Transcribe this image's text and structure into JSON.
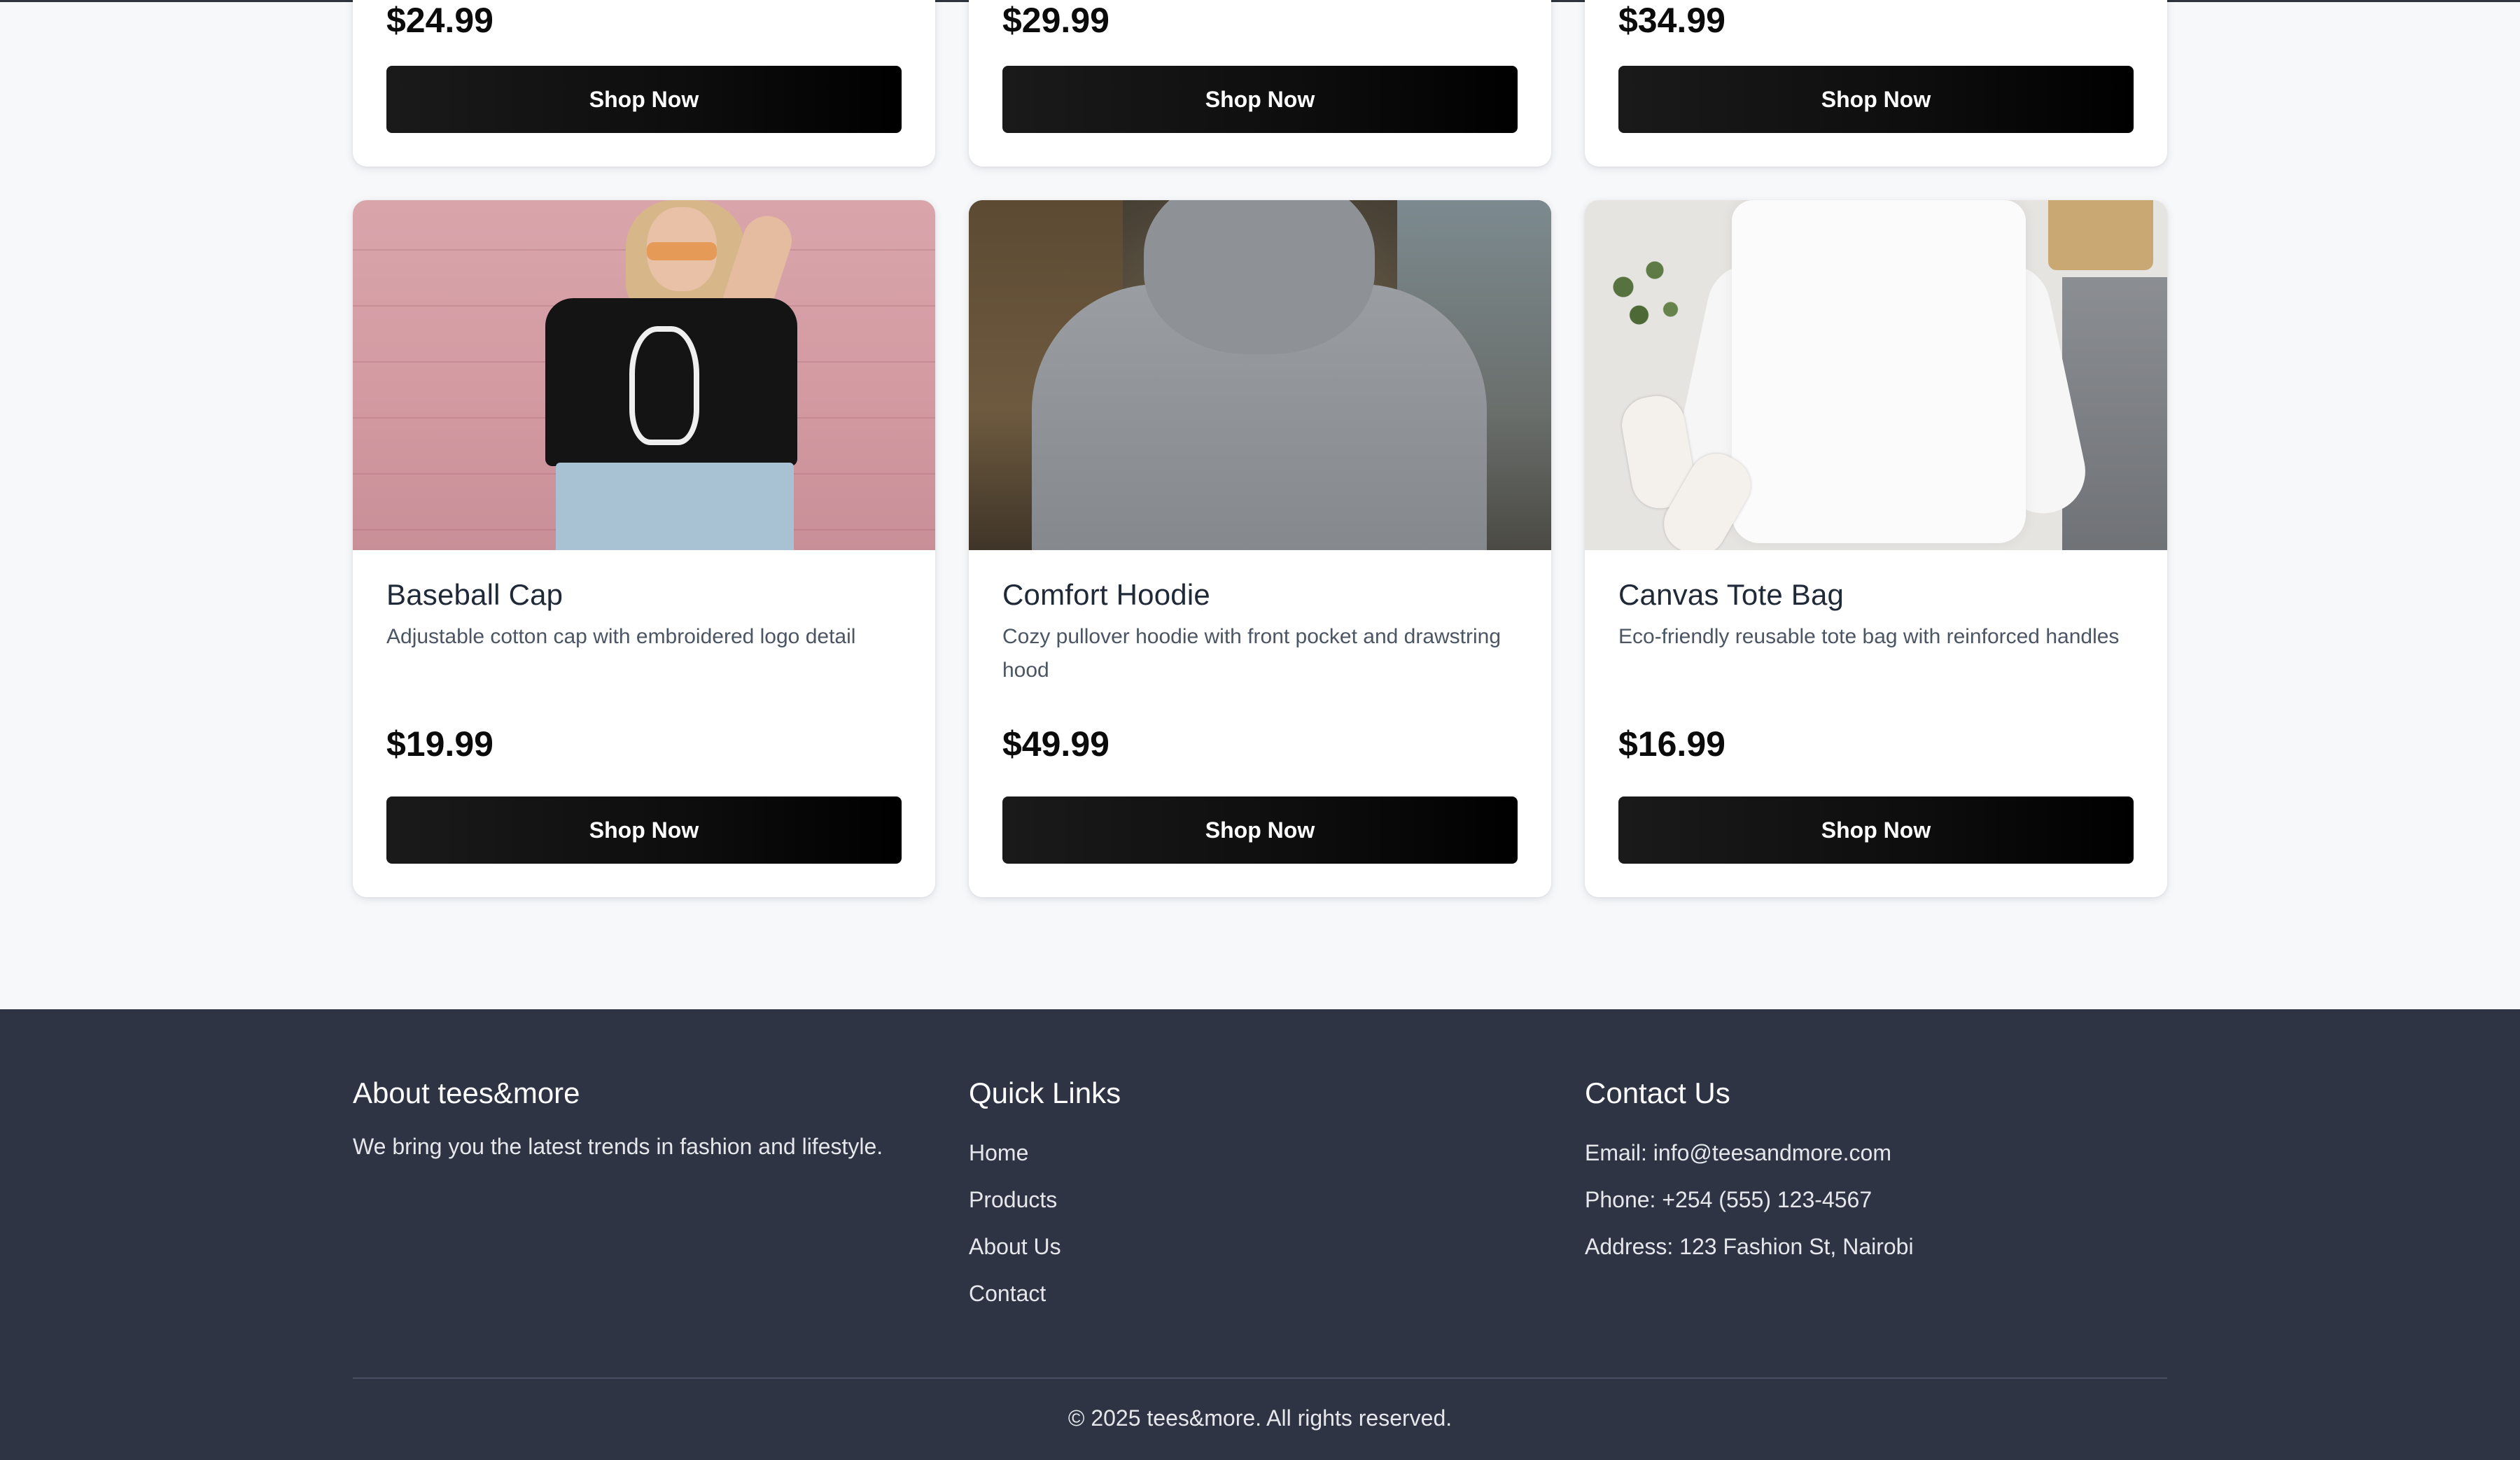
{
  "products_top": [
    {
      "price": "$24.99",
      "button": "Shop Now"
    },
    {
      "price": "$29.99",
      "button": "Shop Now"
    },
    {
      "price": "$34.99",
      "button": "Shop Now"
    }
  ],
  "products": [
    {
      "name": "Baseball Cap",
      "description": "Adjustable cotton cap with embroidered logo detail",
      "price": "$19.99",
      "button": "Shop Now",
      "image": "woman-in-skeleton-tee-photo"
    },
    {
      "name": "Comfort Hoodie",
      "description": "Cozy pullover hoodie with front pocket and drawstring hood",
      "price": "$49.99",
      "button": "Shop Now",
      "image": "grey-hoodie-back-photo"
    },
    {
      "name": "Canvas Tote Bag",
      "description": "Eco-friendly reusable tote bag with reinforced handles",
      "price": "$16.99",
      "button": "Shop Now",
      "image": "white-sweatshirt-flatlay-photo"
    }
  ],
  "footer": {
    "about": {
      "heading": "About tees&more",
      "text": "We bring you the latest trends in fashion and lifestyle."
    },
    "quick_links": {
      "heading": "Quick Links",
      "links": [
        "Home",
        "Products",
        "About Us",
        "Contact"
      ]
    },
    "contact": {
      "heading": "Contact Us",
      "email": "Email: info@teesandmore.com",
      "phone": "Phone: +254 (555) 123-4567",
      "address": "Address: 123 Fashion St, Nairobi"
    },
    "copyright": "© 2025 tees&more. All rights reserved."
  },
  "colors": {
    "page_bg": "#f7f8fa",
    "footer_bg": "#2e3444",
    "button_bg": "#000000",
    "button_text": "#ffffff"
  }
}
